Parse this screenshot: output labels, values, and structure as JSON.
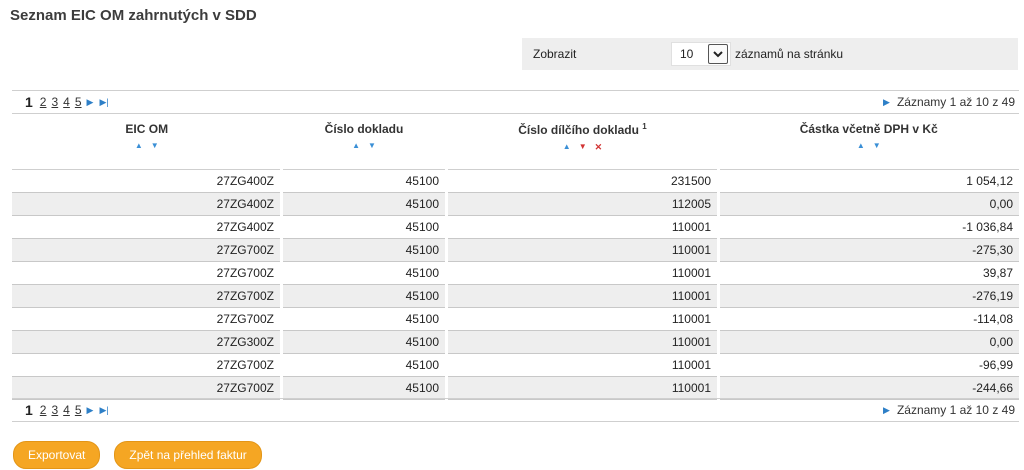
{
  "title": "Seznam EIC OM zahrnutých v SDD",
  "filter": {
    "label": "Zobrazit",
    "page_size": "10",
    "suffix": "záznamů na stránku"
  },
  "pager": {
    "pages": [
      "1",
      "2",
      "3",
      "4",
      "5"
    ],
    "current": "1",
    "info": "Záznamy 1 až 10 z 49"
  },
  "columns": [
    {
      "label": "EIC OM",
      "footnote": ""
    },
    {
      "label": "Číslo dokladu",
      "footnote": ""
    },
    {
      "label": "Číslo dílčího dokladu",
      "footnote": "1"
    },
    {
      "label": "Částka včetně DPH v Kč",
      "footnote": ""
    }
  ],
  "rows": [
    [
      "27ZG400Z",
      "45100",
      "231500",
      "1 054,12"
    ],
    [
      "27ZG400Z",
      "45100",
      "112005",
      "0,00"
    ],
    [
      "27ZG400Z",
      "45100",
      "110001",
      "-1 036,84"
    ],
    [
      "27ZG700Z",
      "45100",
      "110001",
      "-275,30"
    ],
    [
      "27ZG700Z",
      "45100",
      "110001",
      "39,87"
    ],
    [
      "27ZG700Z",
      "45100",
      "110001",
      "-276,19"
    ],
    [
      "27ZG700Z",
      "45100",
      "110001",
      "-114,08"
    ],
    [
      "27ZG300Z",
      "45100",
      "110001",
      "0,00"
    ],
    [
      "27ZG700Z",
      "45100",
      "110001",
      "-96,99"
    ],
    [
      "27ZG700Z",
      "45100",
      "110001",
      "-244,66"
    ]
  ],
  "buttons": {
    "export": "Exportovat",
    "back": "Zpět na přehled faktur"
  },
  "colors": {
    "accent_orange": "#f5a623",
    "sort_blue": "#3a8fd6",
    "sort_red": "#d23333",
    "row_alt": "#eeeeee"
  }
}
